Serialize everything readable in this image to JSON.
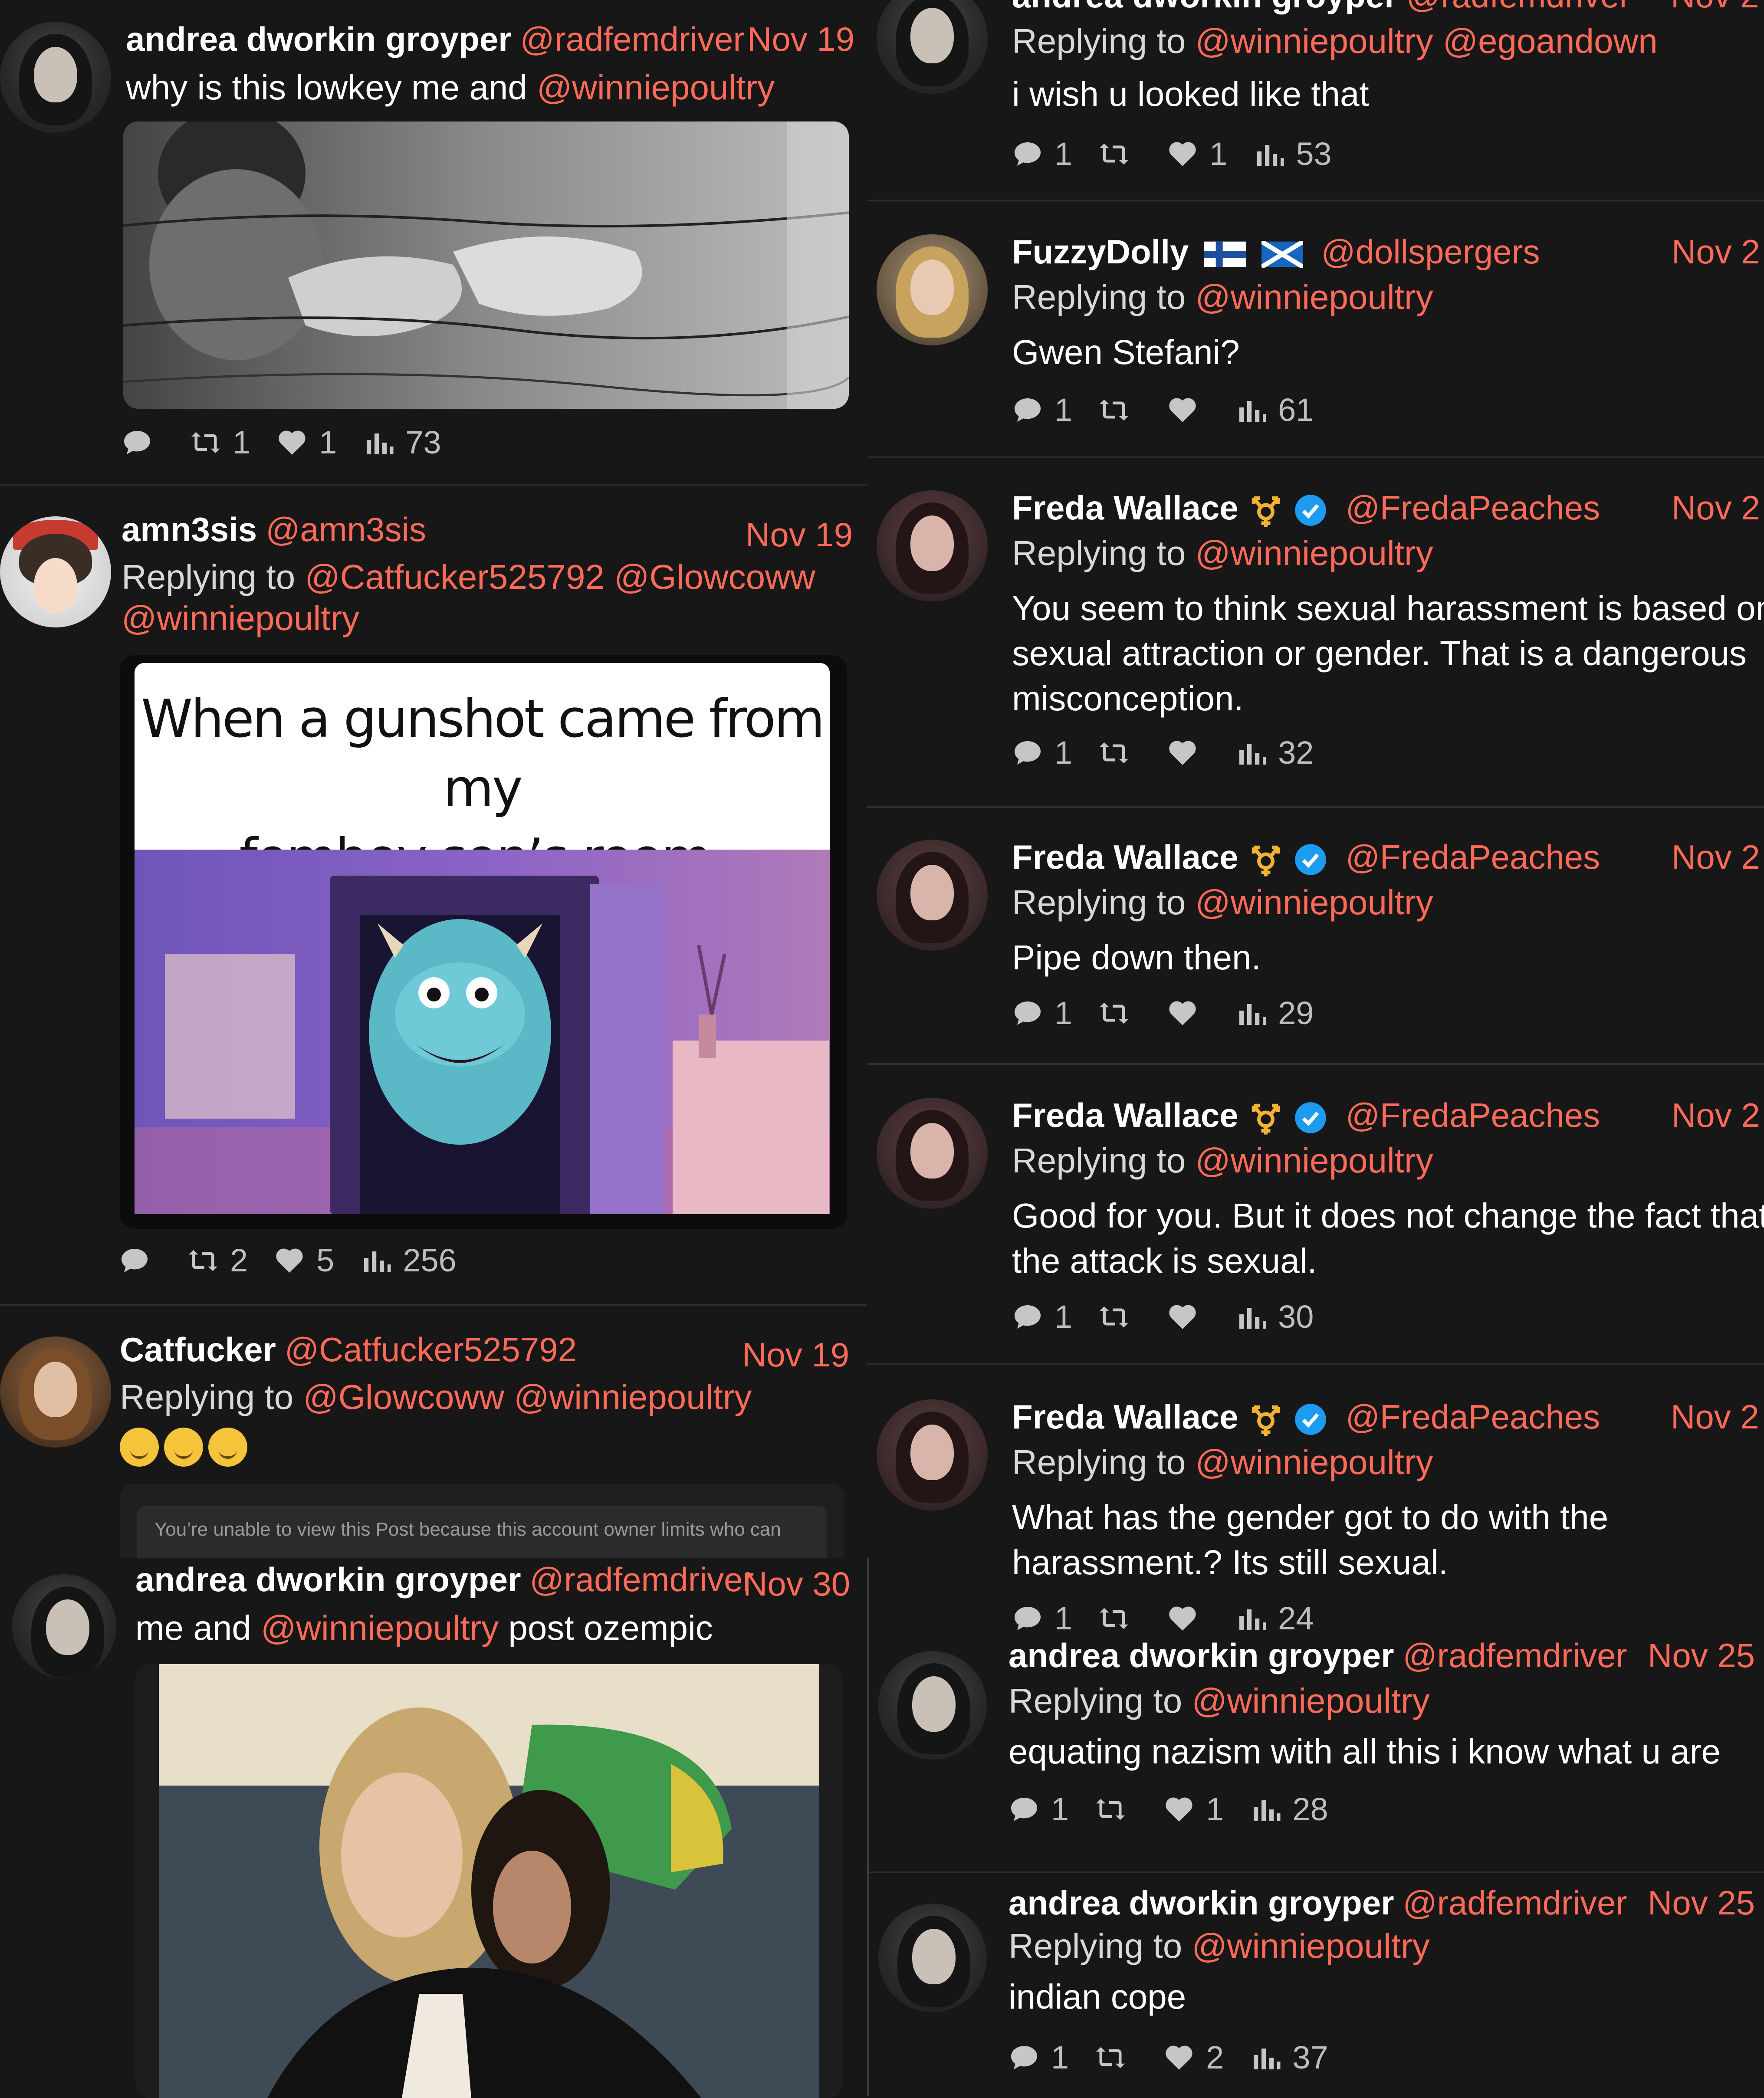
{
  "tweets_left": [
    {
      "name": "andrea dworkin groyper",
      "handle": "@radfemdriver",
      "date": "Nov 19",
      "text_parts": [
        "why is this lowkey me and ",
        "@winniepoultry"
      ],
      "replies": "",
      "retweets": "1",
      "likes": "1",
      "views": "73",
      "media": "black-and-white-barbed-wire-photo"
    },
    {
      "name": "amn3sis",
      "handle": "@amn3sis",
      "date": "Nov 19",
      "replying_label": "Replying to",
      "replying_to_line1": "@Catfucker525792 @Glowcoww",
      "replying_to_line2": "@winniepoultry",
      "meme_caption_line1": "When a gunshot came from my",
      "meme_caption_line2": "femboy son’s room.",
      "replies": "",
      "retweets": "2",
      "likes": "5",
      "views": "256",
      "media": "sulley-doorway-meme"
    },
    {
      "name": "Catfucker",
      "handle": "@Catfucker525792",
      "date": "Nov 19",
      "replying_label": "Replying to",
      "replying_to": "@Glowcoww @winniepoultry",
      "emoji_count_label": "🥲🥲🥲",
      "blocked_notice": "You’re unable to view this Post because this account owner limits who can"
    },
    {
      "name": "andrea dworkin groyper",
      "handle": "@radfemdriver",
      "date": "Nov 30",
      "text_parts": [
        "me and ",
        "@winniepoultry",
        " post ozempic"
      ],
      "media": "two-women-photo"
    }
  ],
  "tweets_right": [
    {
      "name": "andrea dworkin groyper",
      "handle": "@radfemdriver",
      "date": "Nov 2",
      "replying_label": "Replying to",
      "replying_to": "@winniepoultry @egoandown",
      "text": "i wish u looked like that",
      "replies": "1",
      "retweets": "",
      "likes": "1",
      "views": "53"
    },
    {
      "name": "FuzzyDolly",
      "handle": "@dollspergers",
      "date": "Nov 2",
      "replying_label": "Replying to",
      "replying_to": "@winniepoultry",
      "text": "Gwen Stefani?",
      "replies": "1",
      "retweets": "",
      "likes": "",
      "views": "61"
    },
    {
      "name": "Freda Wallace",
      "handle": "@FredaPeaches",
      "date": "Nov 2",
      "replying_label": "Replying to",
      "replying_to": "@winniepoultry",
      "text_lines": [
        "You seem to think sexual harassment is based on",
        "sexual attraction or gender. That is a dangerous",
        "misconception."
      ],
      "replies": "1",
      "retweets": "",
      "likes": "",
      "views": "32"
    },
    {
      "name": "Freda Wallace",
      "handle": "@FredaPeaches",
      "date": "Nov 2",
      "replying_label": "Replying to",
      "replying_to": "@winniepoultry",
      "text_lines": [
        "Pipe down then."
      ],
      "replies": "1",
      "retweets": "",
      "likes": "",
      "views": "29"
    },
    {
      "name": "Freda Wallace",
      "handle": "@FredaPeaches",
      "date": "Nov 2",
      "replying_label": "Replying to",
      "replying_to": "@winniepoultry",
      "text_lines": [
        "Good for you. But it does not change the fact that",
        "the attack is sexual."
      ],
      "replies": "1",
      "retweets": "",
      "likes": "",
      "views": "30"
    },
    {
      "name": "Freda Wallace",
      "handle": "@FredaPeaches",
      "date": "Nov 2",
      "replying_label": "Replying to",
      "replying_to": "@winniepoultry",
      "text_lines": [
        "What has the gender got to do with the",
        "harassment.? Its still sexual."
      ],
      "replies": "1",
      "retweets": "",
      "likes": "",
      "views": "24"
    },
    {
      "name": "andrea dworkin groyper",
      "handle": "@radfemdriver",
      "date": "Nov 25",
      "replying_label": "Replying to",
      "replying_to": "@winniepoultry",
      "text_lines": [
        "equating nazism with all this i know what u are"
      ],
      "replies": "1",
      "retweets": "",
      "likes": "1",
      "views": "28"
    },
    {
      "name": "andrea dworkin groyper",
      "handle": "@radfemdriver",
      "date": "Nov 25",
      "replying_label": "Replying to",
      "replying_to": "@winniepoultry",
      "text_lines": [
        "indian cope"
      ],
      "replies": "1",
      "retweets": "",
      "likes": "2",
      "views": "37"
    }
  ],
  "colors": {
    "background": "#171717",
    "accent_link": "#ff6a59",
    "verified_blue": "#1d9bf0",
    "trans_symbol": "#f2b233"
  },
  "icons": [
    "reply-icon",
    "retweet-icon",
    "like-icon",
    "views-icon",
    "verified-badge-icon",
    "trans-symbol-icon",
    "finland-flag-icon",
    "scotland-flag-icon"
  ]
}
